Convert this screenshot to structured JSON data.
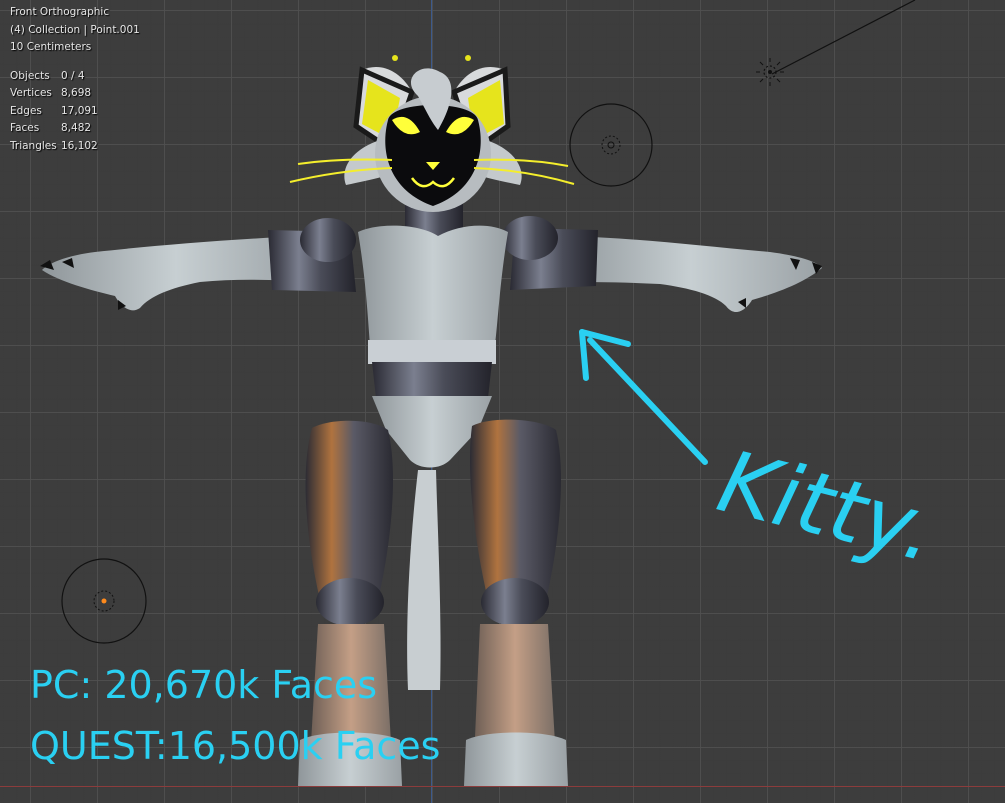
{
  "viewport": {
    "view_name": "Front Orthographic",
    "collection_info": "(4) Collection | Point.001",
    "scale_info": "10 Centimeters",
    "stats": [
      {
        "label": "Objects",
        "value": "0 / 4"
      },
      {
        "label": "Vertices",
        "value": "8,698"
      },
      {
        "label": "Edges",
        "value": "17,091"
      },
      {
        "label": "Faces",
        "value": "8,482"
      },
      {
        "label": "Triangles",
        "value": "16,102"
      }
    ]
  },
  "annotations": {
    "pc_faces": "PC: 20,670k Faces",
    "quest_faces": "QUEST:16,500k Faces",
    "handwritten_label": "Kitty."
  },
  "colors": {
    "grid_background": "#3d3d3d",
    "annotation_cyan": "#2ad0f2",
    "z_axis": "#3c5a8c",
    "x_axis": "#8c3c3c"
  }
}
